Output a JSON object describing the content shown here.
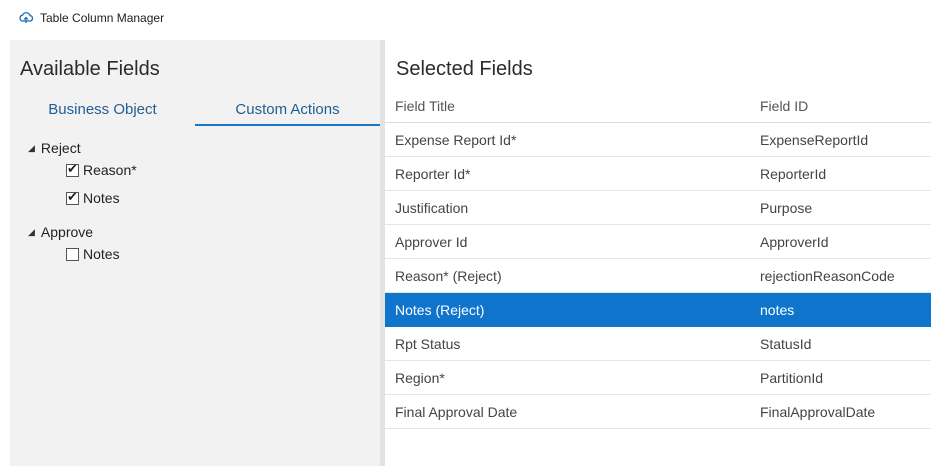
{
  "window": {
    "title": "Table Column Manager",
    "icon": "cloud-icon"
  },
  "left": {
    "title": "Available Fields",
    "tabs": [
      {
        "label": "Business Object",
        "active": false
      },
      {
        "label": "Custom Actions",
        "active": true
      }
    ],
    "tree": [
      {
        "label": "Reject",
        "expanded": true,
        "children": [
          {
            "label": "Reason*",
            "checked": true
          },
          {
            "label": "Notes",
            "checked": true
          }
        ]
      },
      {
        "label": "Approve",
        "expanded": true,
        "children": [
          {
            "label": "Notes",
            "checked": false
          }
        ]
      }
    ],
    "tick_glyph": "✔",
    "expanded_glyph": "◢"
  },
  "right": {
    "title": "Selected Fields",
    "headers": {
      "title": "Field Title",
      "id": "Field ID"
    },
    "rows": [
      {
        "title": "Expense Report Id*",
        "id": "ExpenseReportId",
        "selected": false
      },
      {
        "title": "Reporter Id*",
        "id": "ReporterId",
        "selected": false
      },
      {
        "title": "Justification",
        "id": "Purpose",
        "selected": false
      },
      {
        "title": "Approver Id",
        "id": "ApproverId",
        "selected": false
      },
      {
        "title": "Reason* (Reject)",
        "id": "rejectionReasonCode",
        "selected": false
      },
      {
        "title": "Notes (Reject)",
        "id": "notes",
        "selected": true
      },
      {
        "title": "Rpt Status",
        "id": "StatusId",
        "selected": false
      },
      {
        "title": "Region*",
        "id": "PartitionId",
        "selected": false
      },
      {
        "title": "Final Approval Date",
        "id": "FinalApprovalDate",
        "selected": false
      }
    ]
  },
  "colors": {
    "accent": "#0f74cc",
    "tab_text": "#1f5e94",
    "left_bg": "#f2f2f2"
  }
}
